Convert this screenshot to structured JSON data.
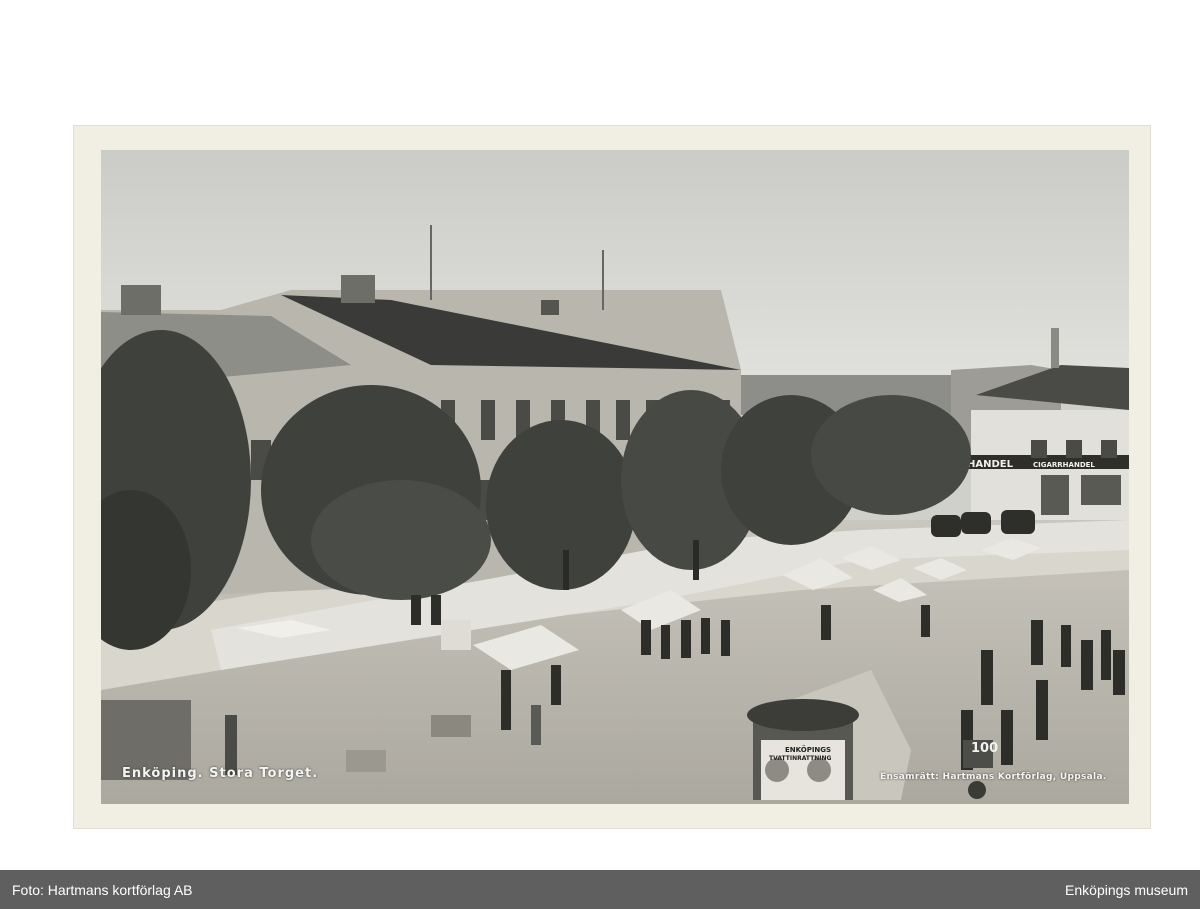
{
  "photo": {
    "caption_left": "Enköping. Stora Torget.",
    "caption_right": "Ensamrätt: Hartmans Kortförlag, Uppsala.",
    "sign_left": "HANDEL",
    "sign_right": "CIGARRHANDEL",
    "kiosk_top": "ENKÖPINGS",
    "kiosk_mid": "TVATTINRATTNING",
    "cart_number": "100",
    "description_icon": "sepia-photo"
  },
  "footer": {
    "credit": "Foto: Hartmans kortförlag AB",
    "museum": "Enköpings museum"
  },
  "colors": {
    "footer_bg": "#5f5f5f",
    "card_border": "#f1eee4",
    "sky": "#d8d8d4",
    "trees": "#3f413d"
  }
}
